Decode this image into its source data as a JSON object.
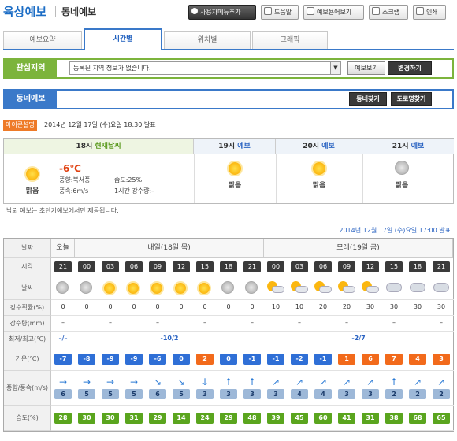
{
  "header": {
    "title": "육상예보",
    "subtitle": "동네예보",
    "buttons": [
      {
        "label": "사용자메뉴추가"
      },
      {
        "label": "도움말"
      },
      {
        "label": "예보용어보기"
      },
      {
        "label": "스크랩"
      },
      {
        "label": "인쇄"
      }
    ]
  },
  "tabs": [
    {
      "label": "예보요약"
    },
    {
      "label": "시간별"
    },
    {
      "label": "위치별"
    },
    {
      "label": "그래픽"
    }
  ],
  "active_tab": "시간별",
  "interest": {
    "label": "관심지역",
    "select_value": "등록된 지역 정보가 없습니다.",
    "btn_view": "예보보기",
    "btn_change": "변경하기"
  },
  "local": {
    "label": "동네예보",
    "btn_find": "동네찾기",
    "btn_road": "도로명찾기"
  },
  "icon_info_label": "아이콘설명",
  "announce_time": "2014년 12월 17일 (수)요일 18:30 발표",
  "current": {
    "head_time": "18시",
    "head_label": "현재날씨",
    "weather": "맑음",
    "temp": "-6℃",
    "wind_dir": "풍향:북서풍",
    "humidity": "습도:25%",
    "wind_speed": "풍속:6m/s",
    "rain": "1시간 강수량:–",
    "slots": [
      {
        "time": "19시",
        "label": "예보",
        "weather": "맑음"
      },
      {
        "time": "20시",
        "label": "예보",
        "weather": "맑음"
      },
      {
        "time": "21시",
        "label": "예보",
        "weather": "맑음"
      }
    ]
  },
  "note": "낙뢰 예보는 초단기예보에서만 제공됩니다.",
  "forecast_time": "2014년 12월 17일 (수)요일 17:00 발표",
  "table": {
    "row_labels": {
      "date": "날짜",
      "time": "시각",
      "weather": "날씨",
      "pop": "강수확률(%)",
      "rain": "강수량(mm)",
      "minmax": "최저/최고(℃)",
      "temp": "기온(℃)",
      "wind": "풍향/풍속(m/s)",
      "humidity": "습도(%)"
    },
    "dates": [
      {
        "label": "오늘",
        "span": 1
      },
      {
        "label": "내일(18일 목)",
        "span": 8
      },
      {
        "label": "모레(19일 금)",
        "span": 8
      }
    ],
    "hours": [
      "21",
      "00",
      "03",
      "06",
      "09",
      "12",
      "15",
      "18",
      "21",
      "00",
      "03",
      "06",
      "09",
      "12",
      "15",
      "18",
      "21"
    ],
    "weather": [
      "haze",
      "haze",
      "sun",
      "sun",
      "sun",
      "sun",
      "sun",
      "haze",
      "haze",
      "pcloud",
      "pcloud",
      "pcloud",
      "pcloud",
      "pcloud",
      "cloud",
      "cloud",
      "cloud"
    ],
    "pop": [
      "0",
      "0",
      "0",
      "0",
      "0",
      "0",
      "0",
      "0",
      "0",
      "10",
      "10",
      "20",
      "20",
      "30",
      "30",
      "30",
      "30"
    ],
    "rain": [
      "–",
      "",
      "–",
      "",
      "–",
      "",
      "–",
      "",
      "–",
      "",
      "–",
      "",
      "–",
      "",
      "–",
      "",
      "–"
    ],
    "minmax": [
      {
        "text": "–/–",
        "span": 1
      },
      {
        "text": "-10/2",
        "span": 8
      },
      {
        "text": "-2/7",
        "span": 8
      }
    ],
    "temp": [
      "-7",
      "-8",
      "-9",
      "-9",
      "-6",
      "0",
      "2",
      "0",
      "-1",
      "-1",
      "-2",
      "-1",
      "1",
      "6",
      "7",
      "4",
      "3"
    ],
    "wind_dir": [
      "→",
      "→",
      "→",
      "→",
      "↘",
      "↘",
      "↓",
      "↑",
      "↑",
      "↗",
      "↗",
      "↗",
      "↗",
      "↗",
      "↑",
      "↗",
      "↗"
    ],
    "wind_speed": [
      "6",
      "5",
      "5",
      "5",
      "6",
      "5",
      "3",
      "3",
      "3",
      "3",
      "4",
      "4",
      "3",
      "3",
      "2",
      "2",
      "2"
    ],
    "humidity": [
      "28",
      "30",
      "30",
      "31",
      "29",
      "14",
      "24",
      "29",
      "48",
      "39",
      "45",
      "60",
      "41",
      "31",
      "38",
      "68",
      "65"
    ],
    "colors": {
      "cold": "#2f6fd6",
      "warm": "#f26a1b",
      "humidity": "#5aa51e",
      "wind_bg": "#9db8d8"
    }
  },
  "colors": {
    "accent_blue": "#3a79c9",
    "accent_green": "#7cb43c",
    "orange": "#ee7a28"
  }
}
